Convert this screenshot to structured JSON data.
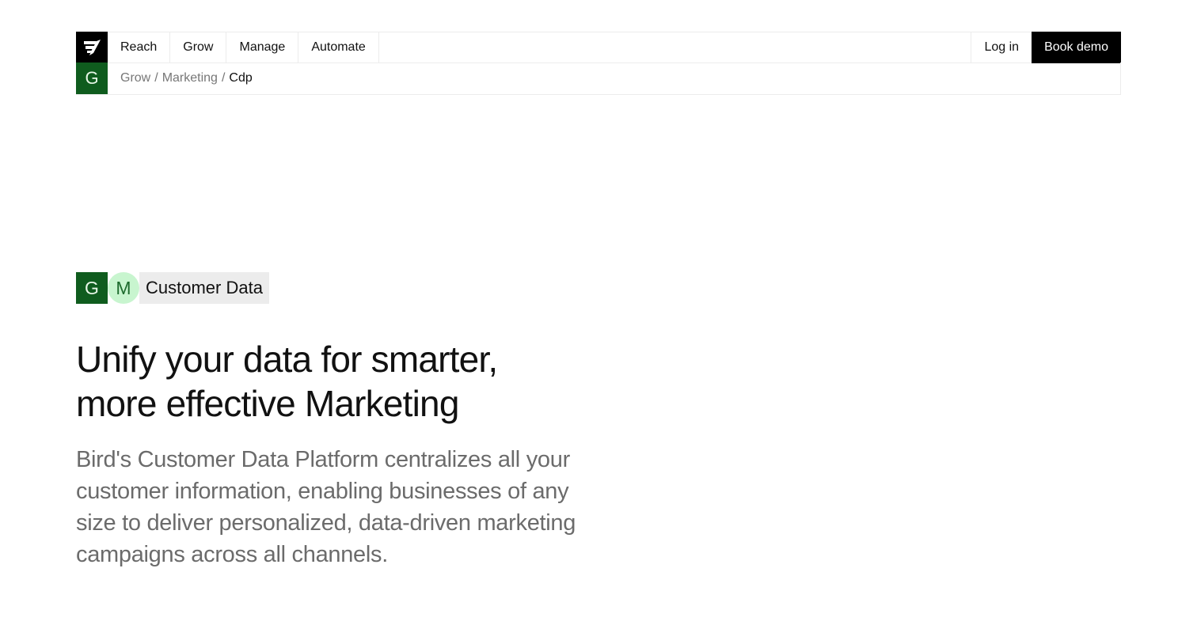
{
  "nav": {
    "logo_icon": "bird-logo-icon",
    "items": [
      {
        "label": "Reach"
      },
      {
        "label": "Grow"
      },
      {
        "label": "Manage"
      },
      {
        "label": "Automate"
      }
    ],
    "login_label": "Log in",
    "book_demo_label": "Book demo"
  },
  "breadcrumb": {
    "badge_letter": "G",
    "badge_color": "#0f5c1e",
    "parts": [
      "Grow",
      "/",
      "Marketing",
      "/"
    ],
    "current": "Cdp"
  },
  "hero": {
    "tag": {
      "g_letter": "G",
      "m_letter": "M",
      "label": "Customer Data",
      "g_color": "#0f5c1e",
      "m_color": "#c8f5cf"
    },
    "headline_line1": "Unify your data for smarter,",
    "headline_line2": "more effective Marketing",
    "description": "Bird's Customer Data Platform centralizes all your customer information, enabling businesses of any size to deliver personalized, data-driven marketing campaigns across all channels."
  }
}
